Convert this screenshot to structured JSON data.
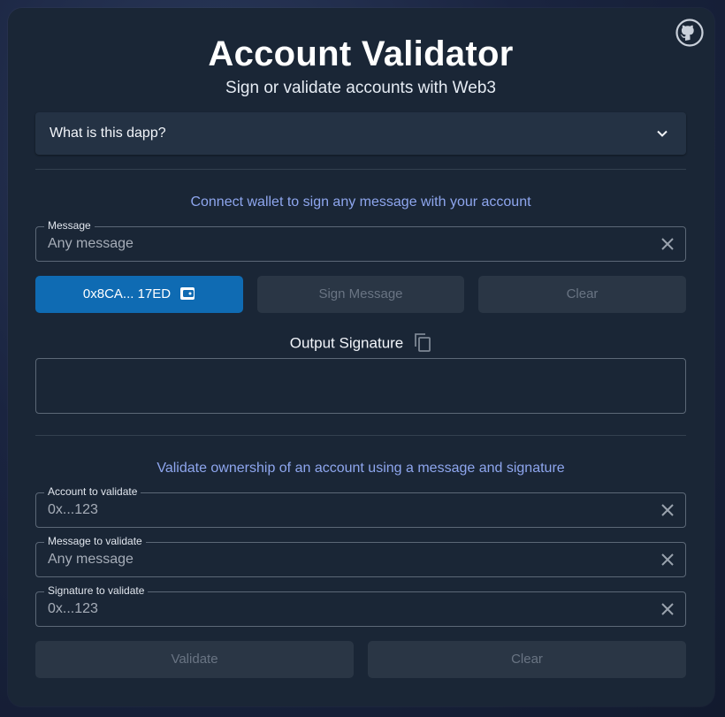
{
  "header": {
    "title": "Account Validator",
    "subtitle": "Sign or validate accounts with Web3",
    "github_icon": "github-icon"
  },
  "faq": {
    "label": "What is this dapp?",
    "icon": "chevron-down-icon"
  },
  "sign_section": {
    "hint": "Connect wallet to sign any message with your account",
    "message_field": {
      "label": "Message",
      "placeholder": "Any message"
    },
    "wallet_button": {
      "label": "0x8CA... 17ED",
      "icon": "wallet-icon"
    },
    "sign_button": {
      "label": "Sign Message"
    },
    "clear_button": {
      "label": "Clear"
    },
    "output": {
      "label": "Output Signature",
      "icon": "copy-icon",
      "value": ""
    }
  },
  "validate_section": {
    "hint": "Validate ownership of an account using a message and signature",
    "account_field": {
      "label": "Account to validate",
      "placeholder": "0x...123"
    },
    "message_field": {
      "label": "Message to validate",
      "placeholder": "Any message"
    },
    "signature_field": {
      "label": "Signature to validate",
      "placeholder": "0x...123"
    },
    "validate_button": {
      "label": "Validate"
    },
    "clear_button": {
      "label": "Clear"
    }
  },
  "colors": {
    "primary": "#0f6bb3",
    "hint": "#8ea6ee",
    "card": "#1a2636",
    "disabled_button": "#2a3645"
  }
}
